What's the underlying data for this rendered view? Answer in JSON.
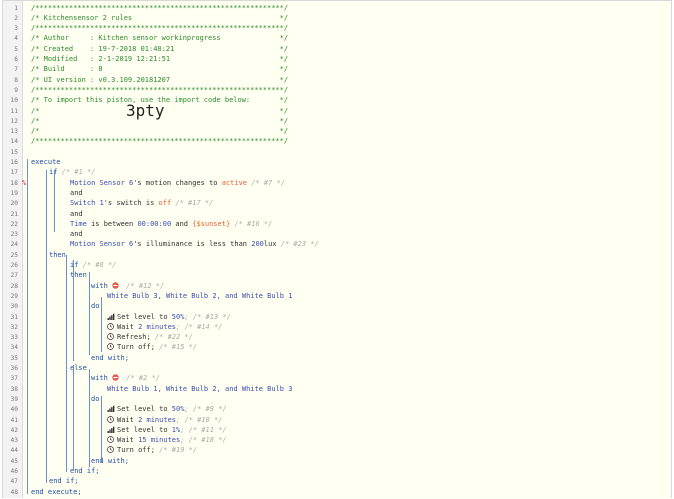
{
  "header_lines": [
    "/***********************************************************/",
    "/* Kitchensensor 2 rules                                   */",
    "/***********************************************************/",
    "/* Author     : Kitchen sensor workinprogress              */",
    "/* Created    : 19-7-2018 01:40:21                         */",
    "/* Modified   : 2-1-2019 12:21:51                          */",
    "/* Build      : 8                                          */",
    "/* UI version : v0.3.109.20181207                          */",
    "/***********************************************************/",
    "/* To import this piston, use the import code below:       */",
    "/*                                                         */",
    "/*                                                         */",
    "/*                                                         */",
    "/***********************************************************/"
  ],
  "import_code": "3pty",
  "code": {
    "execute": "execute",
    "if1": "if",
    "if1_id": "/* #1 */",
    "cond1_dev": "Motion Sensor 6",
    "cond1_rest": "'s motion changes to ",
    "cond1_val": "active",
    "cond1_id": " /* #7 */",
    "and1": "and",
    "cond2_dev": "Switch 1",
    "cond2_rest": "'s switch is ",
    "cond2_val": "off",
    "cond2_id": " /* #17 */",
    "and2": "and",
    "cond3_dev": "Time",
    "cond3_rest": " is between ",
    "cond3_val1": "00:00:00",
    "cond3_and": " and ",
    "cond3_val2": "{$sunset}",
    "cond3_id": " /* #16 */",
    "and3": "and",
    "cond4_dev": "Motion Sensor 6",
    "cond4_rest": "'s illuminance is less than ",
    "cond4_val": "200",
    "cond4_unit": "lux",
    "cond4_id": " /* #23 */",
    "then1": "then",
    "if2": "if",
    "if2_id": "/* #8 */",
    "then2": "then",
    "with1": "with",
    "with1_id": " /* #12 */",
    "with1_devices": "White Bulb 3, White Bulb 2, and White Bulb 1",
    "do1": "do",
    "a1_text": "Set level to ",
    "a1_val": "50%",
    "a1_id": "; /* #13 */",
    "a2_text": "Wait ",
    "a2_val": "2 minutes",
    "a2_id": "; /* #14 */",
    "a3_text": "Refresh;",
    "a3_id": " /* #22 */",
    "a4_text": "Turn off;",
    "a4_id": " /* #15 */",
    "endwith1": "end with;",
    "else": "else",
    "with2": "with",
    "with2_id": " /* #2 */",
    "with2_devices": "White Bulb 1, White Bulb 2, and White Bulb 3",
    "do2": "do",
    "b1_text": "Set level to ",
    "b1_val": "50%",
    "b1_id": "; /* #9 */",
    "b2_text": "Wait ",
    "b2_val": "2 minutes",
    "b2_id": "; /* #10 */",
    "b3_text": "Set level to ",
    "b3_val": "1%",
    "b3_id": "; /* #11 */",
    "b4_text": "Wait ",
    "b4_val": "15 minutes",
    "b4_id": "; /* #18 */",
    "b5_text": "Turn off;",
    "b5_id": " /* #19 */",
    "endwith2": "end with;",
    "endif2": "end if;",
    "endif1": "end if;",
    "endexecute": "end execute;"
  },
  "line_numbers": [
    "1",
    "2",
    "3",
    "4",
    "5",
    "6",
    "7",
    "8",
    "9",
    "10",
    "11",
    "12",
    "13",
    "14",
    "15",
    "16",
    "17",
    "18",
    "19",
    "20",
    "21",
    "22",
    "23",
    "24",
    "25",
    "26",
    "27",
    "28",
    "29",
    "30",
    "31",
    "32",
    "33",
    "34",
    "35",
    "36",
    "37",
    "38",
    "39",
    "40",
    "41",
    "42",
    "43",
    "44",
    "45",
    "46",
    "47",
    "48"
  ],
  "marker_line": "18",
  "marker_symbol": "%",
  "colors": {
    "comment": "#2e8b2e",
    "keyword": "#1f4fa8",
    "device": "#3a4fb0",
    "value": "#e8612c",
    "id": "#aaaaaa"
  },
  "icons": {
    "with": "no-entry-icon",
    "set_level": "signal-bars-icon",
    "wait": "clock-icon",
    "refresh": "clock-icon",
    "turn_off": "clock-icon"
  }
}
